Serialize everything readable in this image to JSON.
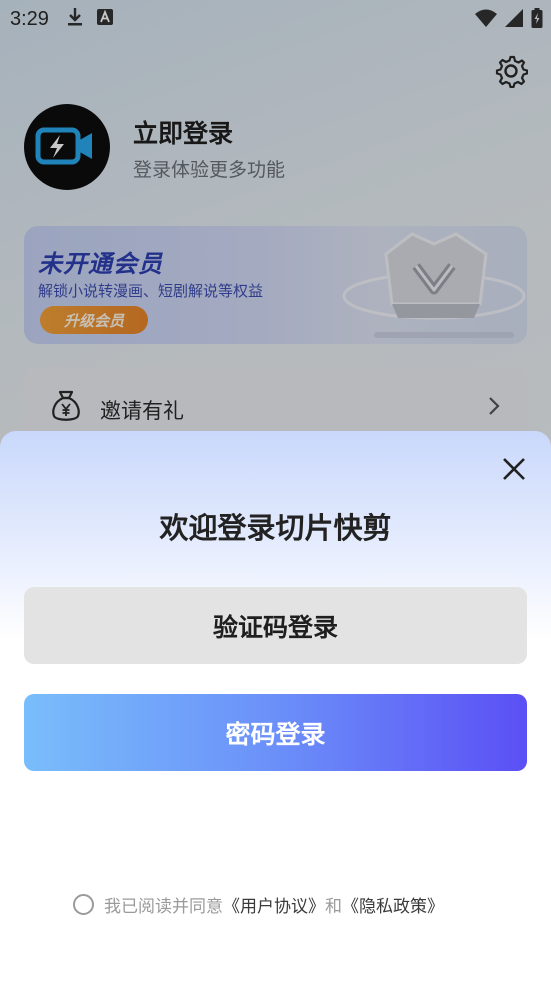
{
  "status_bar": {
    "time": "3:29",
    "icons": [
      "download-icon",
      "keyboard-a-icon",
      "wifi-icon",
      "signal-icon",
      "battery-icon"
    ]
  },
  "profile": {
    "title": "立即登录",
    "subtitle": "登录体验更多功能"
  },
  "vip_card": {
    "title": "未开通会员",
    "description": "解锁小说转漫画、短剧解说等权益",
    "button_label": "升级会员"
  },
  "menu": {
    "invite_label": "邀请有礼"
  },
  "login_sheet": {
    "title": "欢迎登录切片快剪",
    "code_login_label": "验证码登录",
    "password_login_label": "密码登录",
    "agreement_prefix": "我已阅读并同意",
    "user_agreement": "《用户协议》",
    "conjunction": "和",
    "privacy_policy": "《隐私政策》"
  },
  "colors": {
    "primary_gradient_start": "#79bdfb",
    "primary_gradient_end": "#5b4ff5",
    "vip_text": "#2d3fb3",
    "vip_button": "#f2a13a"
  }
}
